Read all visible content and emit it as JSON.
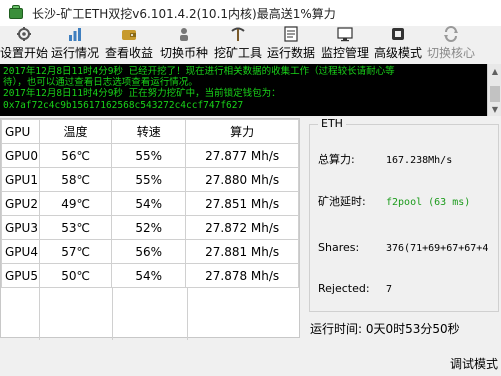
{
  "window": {
    "title": "长沙-矿工ETH双挖v6.101.4.2(10.1内核)最高送1%算力"
  },
  "toolbar": {
    "items": [
      {
        "label": "设置开始",
        "icon": "wrench-gear-icon",
        "enabled": true
      },
      {
        "label": "运行情况",
        "icon": "chart-icon",
        "enabled": true
      },
      {
        "label": "查看收益",
        "icon": "wallet-icon",
        "enabled": true
      },
      {
        "label": "切换币种",
        "icon": "coin-switch-icon",
        "enabled": true
      },
      {
        "label": "挖矿工具",
        "icon": "pickaxe-icon",
        "enabled": true
      },
      {
        "label": "运行数据",
        "icon": "data-icon",
        "enabled": true
      },
      {
        "label": "监控管理",
        "icon": "monitor-icon",
        "enabled": true
      },
      {
        "label": "高级模式",
        "icon": "advanced-icon",
        "enabled": true
      },
      {
        "label": "切换核心",
        "icon": "core-switch-icon",
        "enabled": false
      }
    ]
  },
  "log": {
    "lines": [
      "2017年12月8日11时4分9秒 已经开挖了！现在进行相关数据的收集工作（过程较长请耐心等",
      "待），也可以通过查看日志选项查看运行情况。",
      "2017年12月8日11时4分9秒 正在努力挖矿中，当前锁定钱包为：",
      "0x7af72c4c9b15617162568c543272c4ccf747f627"
    ]
  },
  "gpu_table": {
    "headers": {
      "gpu": "GPU",
      "temp": "温度",
      "fan": "转速",
      "hash": "算力"
    },
    "rows": [
      {
        "gpu": "GPU0",
        "temp": "56℃",
        "fan": "55%",
        "hash": "27.877 Mh/s"
      },
      {
        "gpu": "GPU1",
        "temp": "58℃",
        "fan": "55%",
        "hash": "27.880 Mh/s"
      },
      {
        "gpu": "GPU2",
        "temp": "49℃",
        "fan": "54%",
        "hash": "27.851 Mh/s"
      },
      {
        "gpu": "GPU3",
        "temp": "53℃",
        "fan": "52%",
        "hash": "27.872 Mh/s"
      },
      {
        "gpu": "GPU4",
        "temp": "57℃",
        "fan": "56%",
        "hash": "27.881 Mh/s"
      },
      {
        "gpu": "GPU5",
        "temp": "50℃",
        "fan": "54%",
        "hash": "27.878 Mh/s"
      }
    ]
  },
  "eth": {
    "legend": "ETH",
    "total_hash_label": "总算力:",
    "total_hash_value": "167.238Mh/s",
    "pool_latency_label": "矿池延时:",
    "pool_latency_value": "f2pool (63 ms)",
    "shares_label": "Shares:",
    "shares_value": "376(71+69+67+67+4",
    "rejected_label": "Rejected:",
    "rejected_value": "7",
    "pool_color": "#1b9b1b"
  },
  "status": {
    "runtime": "运行时间: 0天0时53分50秒",
    "debug_mode": "调试模式"
  }
}
